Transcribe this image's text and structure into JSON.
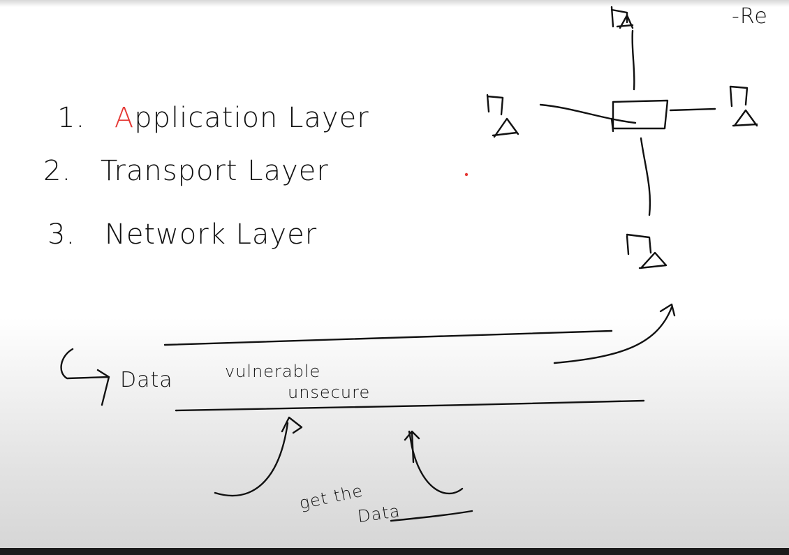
{
  "notes": {
    "layers": [
      {
        "number": "1.",
        "first_letter": "A",
        "rest": "pplication Layer"
      },
      {
        "number": "2.",
        "label": "Transport Layer"
      },
      {
        "number": "3.",
        "label": "Network Layer"
      }
    ],
    "data_note": {
      "label": "Data",
      "line1": "vulnerable",
      "line2": "unsecure"
    },
    "get_the_data": {
      "line1": "get the",
      "line2": "Data"
    },
    "corner_text": "-Re"
  },
  "colors": {
    "ink": "#111111",
    "accent": "#e53935"
  }
}
